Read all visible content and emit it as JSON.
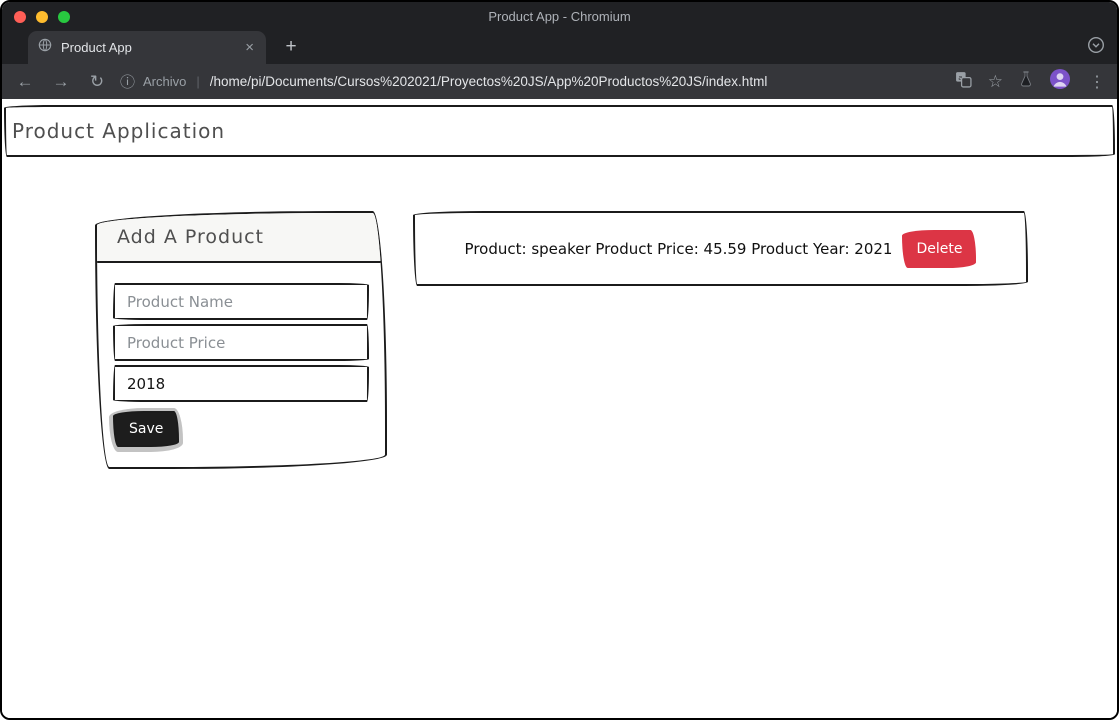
{
  "window": {
    "title": "Product App - Chromium"
  },
  "tab": {
    "title": "Product App"
  },
  "icons": {
    "back": "←",
    "forward": "→",
    "reload": "↻",
    "info": "ⓘ",
    "star": "☆",
    "kebab": "⋮",
    "close": "×",
    "new_tab": "+",
    "separator": "|"
  },
  "toolbar": {
    "info_label": "Archivo",
    "url": "/home/pi/Documents/Cursos%202021/Proyectos%20JS/App%20Productos%20JS/index.html"
  },
  "page": {
    "header": "Product Application",
    "form": {
      "title": "Add A Product",
      "name_placeholder": "Product Name",
      "price_placeholder": "Product Price",
      "year_value": "2018",
      "save_label": "Save"
    },
    "products": [
      {
        "text": "Product: speaker Product Price: 45.59 Product Year: 2021",
        "delete_label": "Delete"
      }
    ]
  },
  "colors": {
    "danger": "#dc3545",
    "dark_button": "#1d1d1d",
    "frame": "#202124",
    "toolbar": "#35363a",
    "avatar": "#7c52c9"
  }
}
